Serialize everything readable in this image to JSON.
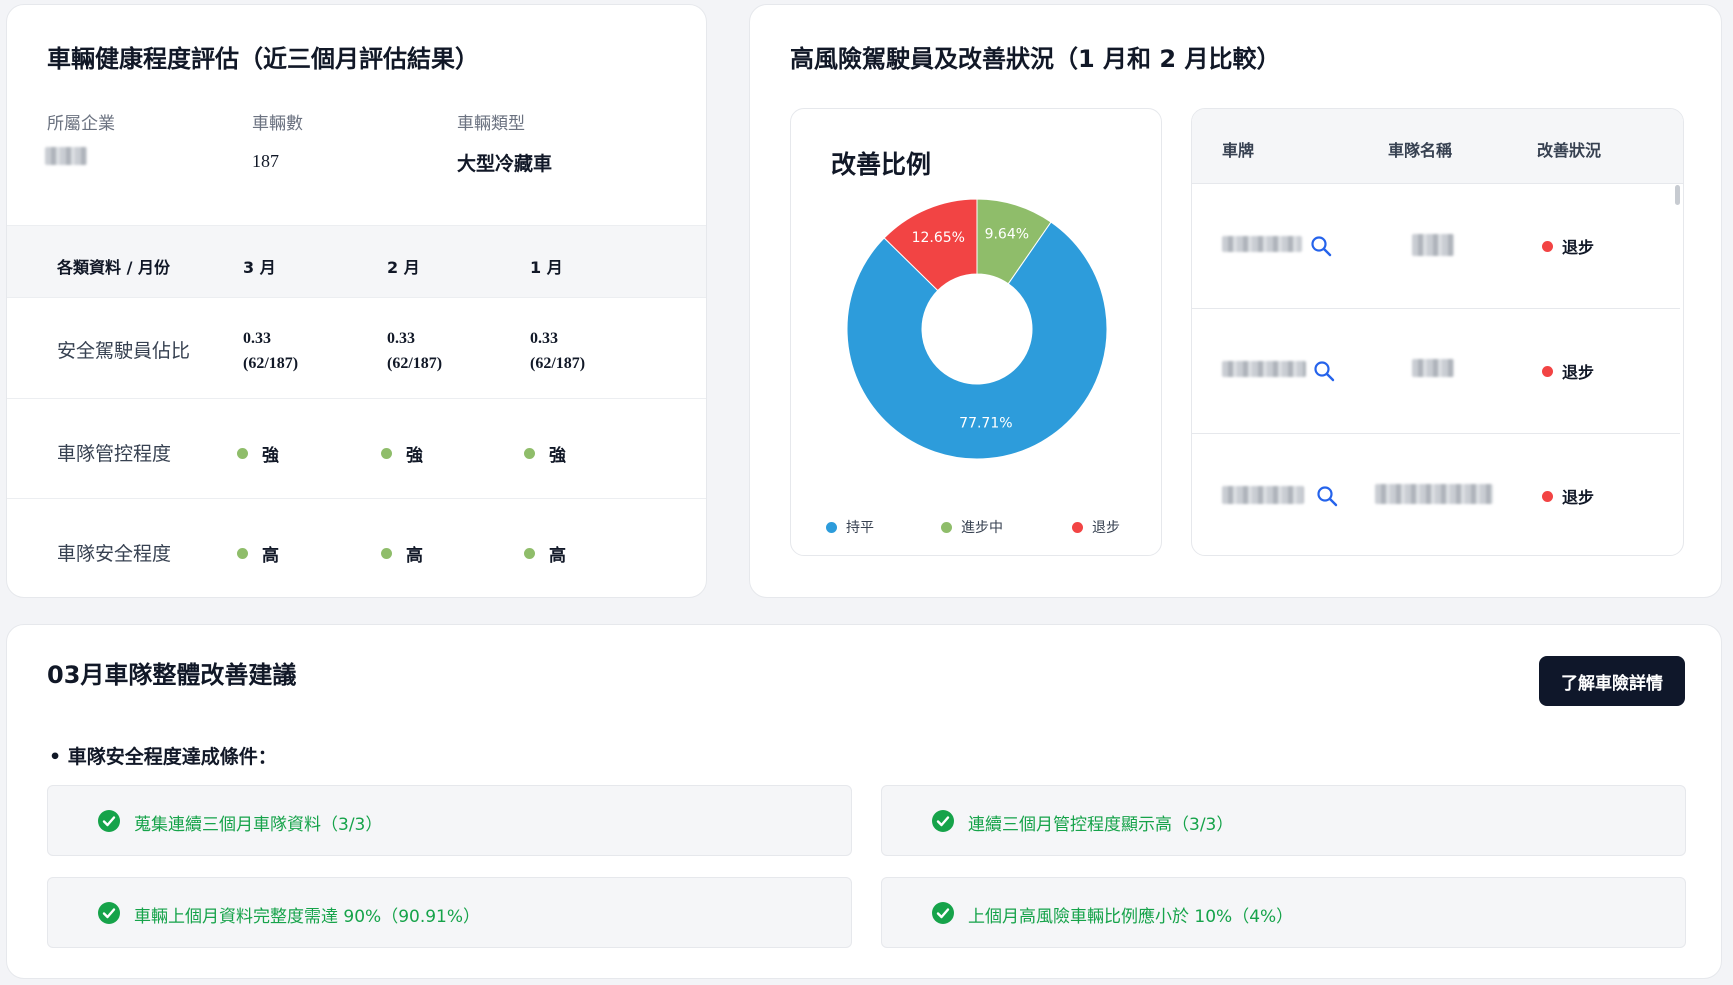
{
  "colors": {
    "flat": "#2d9cdb",
    "improving": "#8fbd6a",
    "regress": "#f24444",
    "green_dot": "#8fbd6a",
    "success": "#16a34a",
    "button_bg": "#0f172a"
  },
  "health": {
    "title": "車輛健康程度評估（近三個月評估結果）",
    "meta": {
      "company_label": "所屬企業",
      "vehicle_count_label": "車輛數",
      "vehicle_count": "187",
      "vehicle_type_label": "車輛類型",
      "vehicle_type": "大型冷藏車"
    },
    "table": {
      "headers": [
        "各類資料 / 月份",
        "3 月",
        "2 月",
        "1 月"
      ],
      "safe_driver": {
        "label": "安全駕駛員佔比",
        "cells": [
          {
            "value": "0.33",
            "fraction": "(62/187)"
          },
          {
            "value": "0.33",
            "fraction": "(62/187)"
          },
          {
            "value": "0.33",
            "fraction": "(62/187)"
          }
        ]
      },
      "control": {
        "label": "車隊管控程度",
        "cells": [
          "強",
          "強",
          "強"
        ]
      },
      "safety": {
        "label": "車隊安全程度",
        "cells": [
          "高",
          "高",
          "高"
        ]
      }
    }
  },
  "risk": {
    "title": "高風險駕駛員及改善狀況（1 月和 2 月比較）",
    "chart_title": "改善比例",
    "chart_data": {
      "type": "pie",
      "donut": true,
      "title": "改善比例",
      "slices": [
        {
          "label": "進步中",
          "value": 9.64,
          "value_label": "9.64%",
          "color": "#8fbd6a"
        },
        {
          "label": "持平",
          "value": 77.71,
          "value_label": "77.71%",
          "color": "#2d9cdb"
        },
        {
          "label": "退步",
          "value": 12.65,
          "value_label": "12.65%",
          "color": "#f24444"
        }
      ],
      "legend": [
        "持平",
        "進步中",
        "退步"
      ],
      "legend_position": "bottom"
    },
    "table": {
      "headers": [
        "車牌",
        "車隊名稱",
        "改善狀況"
      ],
      "rows": [
        {
          "status": "退步"
        },
        {
          "status": "退步"
        },
        {
          "status": "退步"
        }
      ]
    }
  },
  "suggest": {
    "title": "03月車隊整體改善建議",
    "button": "了解車險詳情",
    "subhead": "• 車隊安全程度達成條件：",
    "conditions": [
      "蒐集連續三個月車隊資料（3/3）",
      "連續三個月管控程度顯示高（3/3）",
      "車輛上個月資料完整度需達 90%（90.91%）",
      "上個月高風險車輛比例應小於 10%（4%）"
    ],
    "icons": {
      "check": "check-circle-icon",
      "search": "search-icon"
    }
  }
}
